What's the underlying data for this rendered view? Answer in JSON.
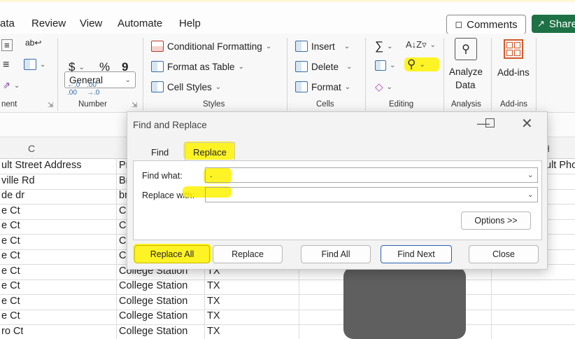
{
  "menu": {
    "tabs": [
      "ata",
      "Review",
      "View",
      "Automate",
      "Help"
    ],
    "comments_label": "Comments",
    "share_label": "Share"
  },
  "ribbon": {
    "alignment_label": "nent",
    "number": {
      "format": "General",
      "currency": "$",
      "percent": "%",
      "comma": "9",
      "label": "Number"
    },
    "styles": {
      "conditional": "Conditional Formatting",
      "format_table": "Format as Table",
      "cell_styles": "Cell Styles",
      "label": "Styles"
    },
    "cells": {
      "insert": "Insert",
      "delete": "Delete",
      "format": "Format",
      "label": "Cells"
    },
    "editing": {
      "label": "Editing"
    },
    "analysis": {
      "line1": "Analyze",
      "line2": "Data",
      "label": "Analysis"
    },
    "addins": {
      "name": "Add-ins",
      "label": "Add-ins"
    }
  },
  "grid": {
    "column_headers": {
      "c": "C",
      "h": "H"
    },
    "header_row": {
      "c": "ult Street Address",
      "d": "Pr",
      "h": "ult Pho"
    },
    "rows": [
      {
        "c": "ville Rd",
        "d": "Br",
        "e": ""
      },
      {
        "c": "de dr",
        "d": "br",
        "e": ""
      },
      {
        "c": "e Ct",
        "d": "Co",
        "e": ""
      },
      {
        "c": "e Ct",
        "d": "Co",
        "e": ""
      },
      {
        "c": "e Ct",
        "d": "Co",
        "e": ""
      },
      {
        "c": "e Ct",
        "d": "Co",
        "e": ""
      },
      {
        "c": "e Ct",
        "d": "College Station",
        "e": "TX"
      },
      {
        "c": "e Ct",
        "d": "College Station",
        "e": "TX"
      },
      {
        "c": "e Ct",
        "d": "College Station",
        "e": "TX"
      },
      {
        "c": "e Ct",
        "d": "College Station",
        "e": "TX"
      },
      {
        "c": "ro Ct",
        "d": "College Station",
        "e": "TX"
      }
    ]
  },
  "dialog": {
    "title": "Find and Replace",
    "tab_find": "Find",
    "tab_replace": "Replace",
    "find_what_label": "Find what:",
    "find_what_value": ".",
    "replace_with_label": "Replace with:",
    "replace_with_value": "",
    "options_label": "Options >>",
    "replace_all": "Replace All",
    "replace": "Replace",
    "find_all": "Find All",
    "find_next": "Find Next",
    "close": "Close"
  }
}
